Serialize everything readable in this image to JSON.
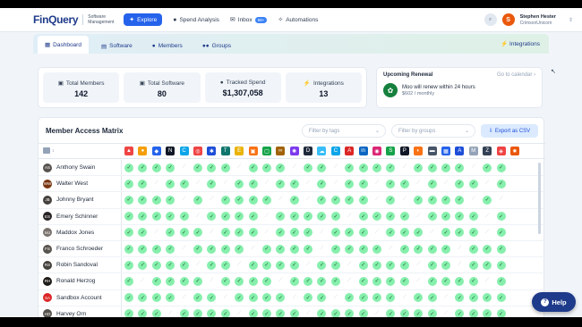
{
  "brand": {
    "name": "FinQuery",
    "sub": "Software Management"
  },
  "nav": [
    {
      "label": "Explore",
      "icon": "compass-icon",
      "glyph": "✦",
      "active": true
    },
    {
      "label": "Spend Analysis",
      "icon": "chart-icon",
      "glyph": "●"
    },
    {
      "label": "Inbox",
      "icon": "inbox-icon",
      "glyph": "✉",
      "badge": "99+"
    },
    {
      "label": "Automations",
      "icon": "automation-icon",
      "glyph": "✧"
    }
  ],
  "user": {
    "initial": "S",
    "name": "Stephen Hester",
    "org": "CrimsonUnicorn"
  },
  "tabs": [
    {
      "label": "Dashboard",
      "glyph": "▦",
      "active": true
    },
    {
      "label": "Software",
      "glyph": "▤"
    },
    {
      "label": "Members",
      "glyph": "●"
    },
    {
      "label": "Groups",
      "glyph": "●●"
    }
  ],
  "tab_right": {
    "label": "Integrations",
    "glyph": "⚡"
  },
  "stats": [
    {
      "label": "Total Members",
      "value": "142",
      "glyph": "▣"
    },
    {
      "label": "Total Software",
      "value": "80",
      "glyph": "▣"
    },
    {
      "label": "Tracked Spend",
      "value": "$1,307,058",
      "glyph": "●"
    },
    {
      "label": "Integrations",
      "value": "13",
      "glyph": "⚡"
    }
  ],
  "renewal": {
    "title": "Upcoming Renewal",
    "link": "Go to calendar ›",
    "line1": "Moo will renew within 24 hours",
    "line2": "$602 / monthly"
  },
  "matrix": {
    "title": "Member Access Matrix",
    "filter_tags": "Filter by tags",
    "filter_groups": "Filter by groups",
    "export": "Export as CSV",
    "sort_label": "↕",
    "apps": [
      {
        "c": "#ef4444",
        "g": "▲"
      },
      {
        "c": "#f59e0b",
        "g": "●"
      },
      {
        "c": "#2563eb",
        "g": "◆"
      },
      {
        "c": "#111827",
        "g": "N"
      },
      {
        "c": "#0ea5e9",
        "g": "C"
      },
      {
        "c": "#ef4444",
        "g": "◎"
      },
      {
        "c": "#1d4ed8",
        "g": "✱"
      },
      {
        "c": "#0f766e",
        "g": "T"
      },
      {
        "c": "#eab308",
        "g": "E"
      },
      {
        "c": "#f97316",
        "g": "▣"
      },
      {
        "c": "#16a34a",
        "g": "▢"
      },
      {
        "c": "#a16207",
        "g": "∞"
      },
      {
        "c": "#7c3aed",
        "g": "✺"
      },
      {
        "c": "#1e293b",
        "g": "D"
      },
      {
        "c": "#38bdf8",
        "g": "☁"
      },
      {
        "c": "#0ea5e9",
        "g": "C"
      },
      {
        "c": "#dc2626",
        "g": "A"
      },
      {
        "c": "#0a66c2",
        "g": "in"
      },
      {
        "c": "#db2777",
        "g": "◉"
      },
      {
        "c": "#16a34a",
        "g": "S"
      },
      {
        "c": "#111827",
        "g": "P"
      },
      {
        "c": "#f97316",
        "g": "◐"
      },
      {
        "c": "#475569",
        "g": "▬"
      },
      {
        "c": "#2563eb",
        "g": "▦"
      },
      {
        "c": "#1d4ed8",
        "g": "A"
      },
      {
        "c": "#94a3b8",
        "g": "M"
      },
      {
        "c": "#334155",
        "g": "Z"
      },
      {
        "c": "#ef4444",
        "g": "◈"
      },
      {
        "c": "#ea580c",
        "g": "✸"
      }
    ],
    "members": [
      {
        "name": "Anthony Swain",
        "initials": "AS",
        "color": "#57534e",
        "access": "1111011101110110111101111011"
      },
      {
        "name": "Walter West",
        "initials": "WW",
        "color": "#78350f",
        "access": "1101101011011010110110101101"
      },
      {
        "name": "Johnny Bryant",
        "initials": "JB",
        "color": "#44403c",
        "access": "1111010111101011110101111010"
      },
      {
        "name": "Emery Schinner",
        "initials": "ES",
        "color": "#292524",
        "access": "1111101111011111011110111101"
      },
      {
        "name": "Maddox Jones",
        "initials": "MJ",
        "color": "#78716c",
        "access": "1101110111011101110111011101"
      },
      {
        "name": "Franco Schroeder",
        "initials": "FS",
        "color": "#57534e",
        "access": "1111011110111101111011110111"
      },
      {
        "name": "Robin Sandoval",
        "initials": "RS",
        "color": "#44403c",
        "access": "1111101101111011011110110111"
      },
      {
        "name": "Ronald Herzog",
        "initials": "RH",
        "color": "#1c1917",
        "access": "1011110111101111011110111101"
      },
      {
        "name": "Sandbox Account",
        "initials": "SA",
        "color": "#dc2626",
        "access": "1111011011110110111101101111"
      },
      {
        "name": "Harvey Orn",
        "initials": "HO",
        "color": "#57534e",
        "access": "1110111101111011110111101111"
      }
    ]
  },
  "help": {
    "label": "Help",
    "glyph": "?"
  }
}
